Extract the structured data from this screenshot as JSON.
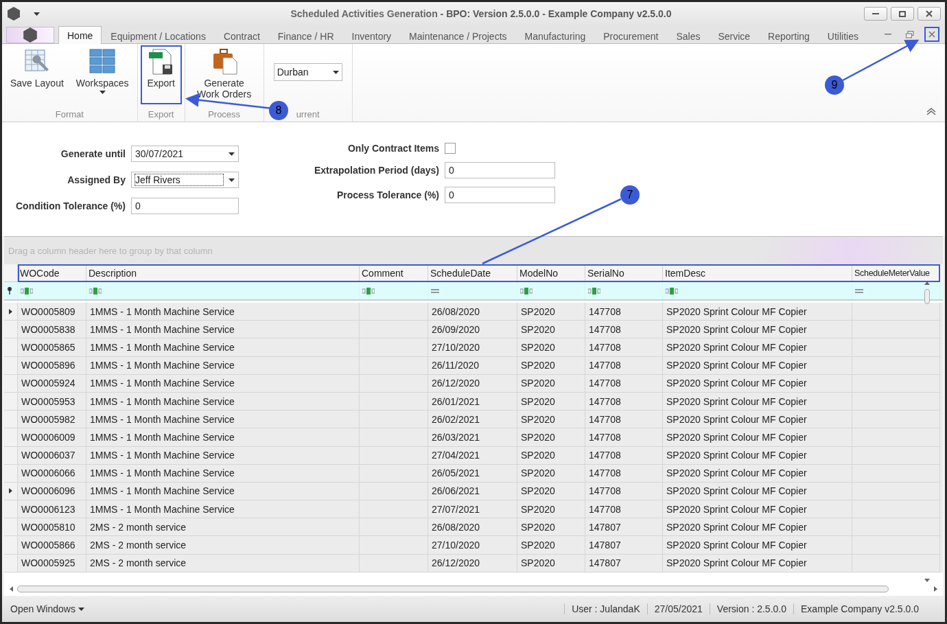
{
  "window": {
    "title_main": "Scheduled Activities Generation",
    "title_rest": " - BPO: Version 2.5.0.0 - Example Company v2.5.0.0",
    "close_highlighted": false,
    "mdi_close_highlighted": true
  },
  "menu_tabs": [
    {
      "label": "Home",
      "selected": true
    },
    {
      "label": "Equipment / Locations",
      "selected": false
    },
    {
      "label": "Contract",
      "selected": false
    },
    {
      "label": "Finance / HR",
      "selected": false
    },
    {
      "label": "Inventory",
      "selected": false
    },
    {
      "label": "Maintenance / Projects",
      "selected": false
    },
    {
      "label": "Manufacturing",
      "selected": false
    },
    {
      "label": "Procurement",
      "selected": false
    },
    {
      "label": "Sales",
      "selected": false
    },
    {
      "label": "Service",
      "selected": false
    },
    {
      "label": "Reporting",
      "selected": false
    },
    {
      "label": "Utilities",
      "selected": false
    }
  ],
  "ribbon_groups": [
    {
      "label": "Format",
      "items": [
        {
          "kind": "layout",
          "label": "Save Layout",
          "has_menu": false,
          "highlighted": false
        },
        {
          "kind": "workspaces",
          "label": "Workspaces",
          "has_menu": true,
          "highlighted": false
        }
      ]
    },
    {
      "label": "Export",
      "items": [
        {
          "kind": "export",
          "label": "Export",
          "has_menu": false,
          "highlighted": true
        }
      ]
    },
    {
      "label": "Process",
      "items": [
        {
          "kind": "briefcase",
          "label": "Generate Work Orders",
          "has_menu": false,
          "highlighted": false
        }
      ]
    },
    {
      "label": "urrent",
      "items": [
        {
          "kind": "dropdown",
          "value": "Durban"
        }
      ]
    }
  ],
  "form_left": [
    {
      "label": "Generate until",
      "kind": "dropdown",
      "value": "30/07/2021",
      "focused": false
    },
    {
      "label": "Assigned By",
      "kind": "dropdown",
      "value": "Jeff Rivers",
      "focused": true
    },
    {
      "label": "Condition Tolerance (%)",
      "kind": "text",
      "value": "0",
      "focused": false
    }
  ],
  "form_right": [
    {
      "label": "Only Contract Items",
      "kind": "checkbox",
      "checked": false
    },
    {
      "label": "Extrapolation Period (days)",
      "kind": "text",
      "value": "0"
    },
    {
      "label": "Process Tolerance (%)",
      "kind": "text",
      "value": "0"
    }
  ],
  "grid": {
    "group_hint": "Drag a column header here to group by that column",
    "header_highlighted": true,
    "columns": [
      {
        "label": "WOCode",
        "kind": "text"
      },
      {
        "label": "Description",
        "kind": "text"
      },
      {
        "label": "Comment",
        "kind": "text"
      },
      {
        "label": "ScheduleDate",
        "kind": "equals"
      },
      {
        "label": "ModelNo",
        "kind": "text"
      },
      {
        "label": "SerialNo",
        "kind": "text"
      },
      {
        "label": "ItemDesc",
        "kind": "text"
      },
      {
        "label": "ScheduleMeterValue",
        "kind": "equals"
      }
    ],
    "rows": [
      {
        "selected": true,
        "cells": [
          "WO0005809",
          "1MMS - 1 Month Machine Service",
          "",
          "26/08/2020",
          "SP2020",
          "147708",
          "SP2020 Sprint Colour MF Copier",
          ""
        ]
      },
      {
        "selected": false,
        "cells": [
          "WO0005838",
          "1MMS - 1 Month Machine Service",
          "",
          "26/09/2020",
          "SP2020",
          "147708",
          "SP2020 Sprint Colour MF Copier",
          ""
        ]
      },
      {
        "selected": false,
        "cells": [
          "WO0005865",
          "1MMS - 1 Month Machine Service",
          "",
          "27/10/2020",
          "SP2020",
          "147708",
          "SP2020 Sprint Colour MF Copier",
          ""
        ]
      },
      {
        "selected": false,
        "cells": [
          "WO0005896",
          "1MMS - 1 Month Machine Service",
          "",
          "26/11/2020",
          "SP2020",
          "147708",
          "SP2020 Sprint Colour MF Copier",
          ""
        ]
      },
      {
        "selected": false,
        "cells": [
          "WO0005924",
          "1MMS - 1 Month Machine Service",
          "",
          "26/12/2020",
          "SP2020",
          "147708",
          "SP2020 Sprint Colour MF Copier",
          ""
        ]
      },
      {
        "selected": false,
        "cells": [
          "WO0005953",
          "1MMS - 1 Month Machine Service",
          "",
          "26/01/2021",
          "SP2020",
          "147708",
          "SP2020 Sprint Colour MF Copier",
          ""
        ]
      },
      {
        "selected": false,
        "cells": [
          "WO0005982",
          "1MMS - 1 Month Machine Service",
          "",
          "26/02/2021",
          "SP2020",
          "147708",
          "SP2020 Sprint Colour MF Copier",
          ""
        ]
      },
      {
        "selected": false,
        "cells": [
          "WO0006009",
          "1MMS - 1 Month Machine Service",
          "",
          "26/03/2021",
          "SP2020",
          "147708",
          "SP2020 Sprint Colour MF Copier",
          ""
        ]
      },
      {
        "selected": false,
        "cells": [
          "WO0006037",
          "1MMS - 1 Month Machine Service",
          "",
          "27/04/2021",
          "SP2020",
          "147708",
          "SP2020 Sprint Colour MF Copier",
          ""
        ]
      },
      {
        "selected": false,
        "cells": [
          "WO0006066",
          "1MMS - 1 Month Machine Service",
          "",
          "26/05/2021",
          "SP2020",
          "147708",
          "SP2020 Sprint Colour MF Copier",
          ""
        ]
      },
      {
        "selected": true,
        "cells": [
          "WO0006096",
          "1MMS - 1 Month Machine Service",
          "",
          "26/06/2021",
          "SP2020",
          "147708",
          "SP2020 Sprint Colour MF Copier",
          ""
        ]
      },
      {
        "selected": false,
        "cells": [
          "WO0006123",
          "1MMS - 1 Month Machine Service",
          "",
          "27/07/2021",
          "SP2020",
          "147708",
          "SP2020 Sprint Colour MF Copier",
          ""
        ]
      },
      {
        "selected": false,
        "cells": [
          "WO0005810",
          "2MS - 2 month service",
          "",
          "26/08/2020",
          "SP2020",
          "147807",
          "SP2020 Sprint Colour MF Copier",
          ""
        ]
      },
      {
        "selected": false,
        "cells": [
          "WO0005866",
          "2MS - 2 month service",
          "",
          "27/10/2020",
          "SP2020",
          "147807",
          "SP2020 Sprint Colour MF Copier",
          ""
        ]
      },
      {
        "selected": false,
        "cells": [
          "WO0005925",
          "2MS - 2 month service",
          "",
          "26/12/2020",
          "SP2020",
          "147807",
          "SP2020 Sprint Colour MF Copier",
          ""
        ]
      }
    ]
  },
  "status_bar": {
    "open_windows": "Open Windows",
    "items": [
      "User : JulandaK",
      "27/05/2021",
      "Version : 2.5.0.0",
      "Example Company v2.5.0.0"
    ]
  },
  "annotations": [
    {
      "label": "7"
    },
    {
      "label": "8"
    },
    {
      "label": "9"
    }
  ]
}
